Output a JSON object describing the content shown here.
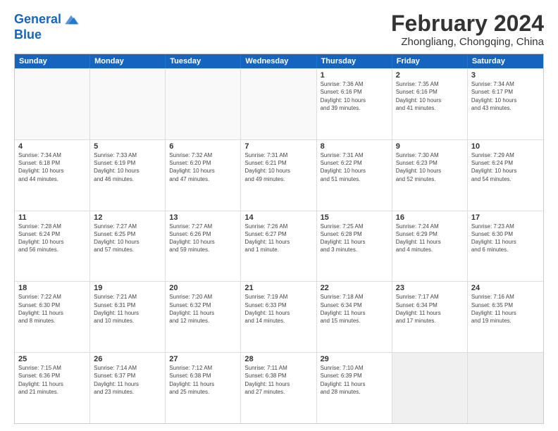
{
  "logo": {
    "line1": "General",
    "line2": "Blue"
  },
  "title": "February 2024",
  "subtitle": "Zhongliang, Chongqing, China",
  "header_days": [
    "Sunday",
    "Monday",
    "Tuesday",
    "Wednesday",
    "Thursday",
    "Friday",
    "Saturday"
  ],
  "weeks": [
    [
      {
        "day": "",
        "info": "",
        "empty": true
      },
      {
        "day": "",
        "info": "",
        "empty": true
      },
      {
        "day": "",
        "info": "",
        "empty": true
      },
      {
        "day": "",
        "info": "",
        "empty": true
      },
      {
        "day": "1",
        "info": "Sunrise: 7:36 AM\nSunset: 6:16 PM\nDaylight: 10 hours\nand 39 minutes."
      },
      {
        "day": "2",
        "info": "Sunrise: 7:35 AM\nSunset: 6:16 PM\nDaylight: 10 hours\nand 41 minutes."
      },
      {
        "day": "3",
        "info": "Sunrise: 7:34 AM\nSunset: 6:17 PM\nDaylight: 10 hours\nand 43 minutes."
      }
    ],
    [
      {
        "day": "4",
        "info": "Sunrise: 7:34 AM\nSunset: 6:18 PM\nDaylight: 10 hours\nand 44 minutes."
      },
      {
        "day": "5",
        "info": "Sunrise: 7:33 AM\nSunset: 6:19 PM\nDaylight: 10 hours\nand 46 minutes."
      },
      {
        "day": "6",
        "info": "Sunrise: 7:32 AM\nSunset: 6:20 PM\nDaylight: 10 hours\nand 47 minutes."
      },
      {
        "day": "7",
        "info": "Sunrise: 7:31 AM\nSunset: 6:21 PM\nDaylight: 10 hours\nand 49 minutes."
      },
      {
        "day": "8",
        "info": "Sunrise: 7:31 AM\nSunset: 6:22 PM\nDaylight: 10 hours\nand 51 minutes."
      },
      {
        "day": "9",
        "info": "Sunrise: 7:30 AM\nSunset: 6:23 PM\nDaylight: 10 hours\nand 52 minutes."
      },
      {
        "day": "10",
        "info": "Sunrise: 7:29 AM\nSunset: 6:24 PM\nDaylight: 10 hours\nand 54 minutes."
      }
    ],
    [
      {
        "day": "11",
        "info": "Sunrise: 7:28 AM\nSunset: 6:24 PM\nDaylight: 10 hours\nand 56 minutes."
      },
      {
        "day": "12",
        "info": "Sunrise: 7:27 AM\nSunset: 6:25 PM\nDaylight: 10 hours\nand 57 minutes."
      },
      {
        "day": "13",
        "info": "Sunrise: 7:27 AM\nSunset: 6:26 PM\nDaylight: 10 hours\nand 59 minutes."
      },
      {
        "day": "14",
        "info": "Sunrise: 7:26 AM\nSunset: 6:27 PM\nDaylight: 11 hours\nand 1 minute."
      },
      {
        "day": "15",
        "info": "Sunrise: 7:25 AM\nSunset: 6:28 PM\nDaylight: 11 hours\nand 3 minutes."
      },
      {
        "day": "16",
        "info": "Sunrise: 7:24 AM\nSunset: 6:29 PM\nDaylight: 11 hours\nand 4 minutes."
      },
      {
        "day": "17",
        "info": "Sunrise: 7:23 AM\nSunset: 6:30 PM\nDaylight: 11 hours\nand 6 minutes."
      }
    ],
    [
      {
        "day": "18",
        "info": "Sunrise: 7:22 AM\nSunset: 6:30 PM\nDaylight: 11 hours\nand 8 minutes."
      },
      {
        "day": "19",
        "info": "Sunrise: 7:21 AM\nSunset: 6:31 PM\nDaylight: 11 hours\nand 10 minutes."
      },
      {
        "day": "20",
        "info": "Sunrise: 7:20 AM\nSunset: 6:32 PM\nDaylight: 11 hours\nand 12 minutes."
      },
      {
        "day": "21",
        "info": "Sunrise: 7:19 AM\nSunset: 6:33 PM\nDaylight: 11 hours\nand 14 minutes."
      },
      {
        "day": "22",
        "info": "Sunrise: 7:18 AM\nSunset: 6:34 PM\nDaylight: 11 hours\nand 15 minutes."
      },
      {
        "day": "23",
        "info": "Sunrise: 7:17 AM\nSunset: 6:34 PM\nDaylight: 11 hours\nand 17 minutes."
      },
      {
        "day": "24",
        "info": "Sunrise: 7:16 AM\nSunset: 6:35 PM\nDaylight: 11 hours\nand 19 minutes."
      }
    ],
    [
      {
        "day": "25",
        "info": "Sunrise: 7:15 AM\nSunset: 6:36 PM\nDaylight: 11 hours\nand 21 minutes."
      },
      {
        "day": "26",
        "info": "Sunrise: 7:14 AM\nSunset: 6:37 PM\nDaylight: 11 hours\nand 23 minutes."
      },
      {
        "day": "27",
        "info": "Sunrise: 7:12 AM\nSunset: 6:38 PM\nDaylight: 11 hours\nand 25 minutes."
      },
      {
        "day": "28",
        "info": "Sunrise: 7:11 AM\nSunset: 6:38 PM\nDaylight: 11 hours\nand 27 minutes."
      },
      {
        "day": "29",
        "info": "Sunrise: 7:10 AM\nSunset: 6:39 PM\nDaylight: 11 hours\nand 28 minutes."
      },
      {
        "day": "",
        "info": "",
        "empty": true,
        "shaded": true
      },
      {
        "day": "",
        "info": "",
        "empty": true,
        "shaded": true
      }
    ]
  ]
}
